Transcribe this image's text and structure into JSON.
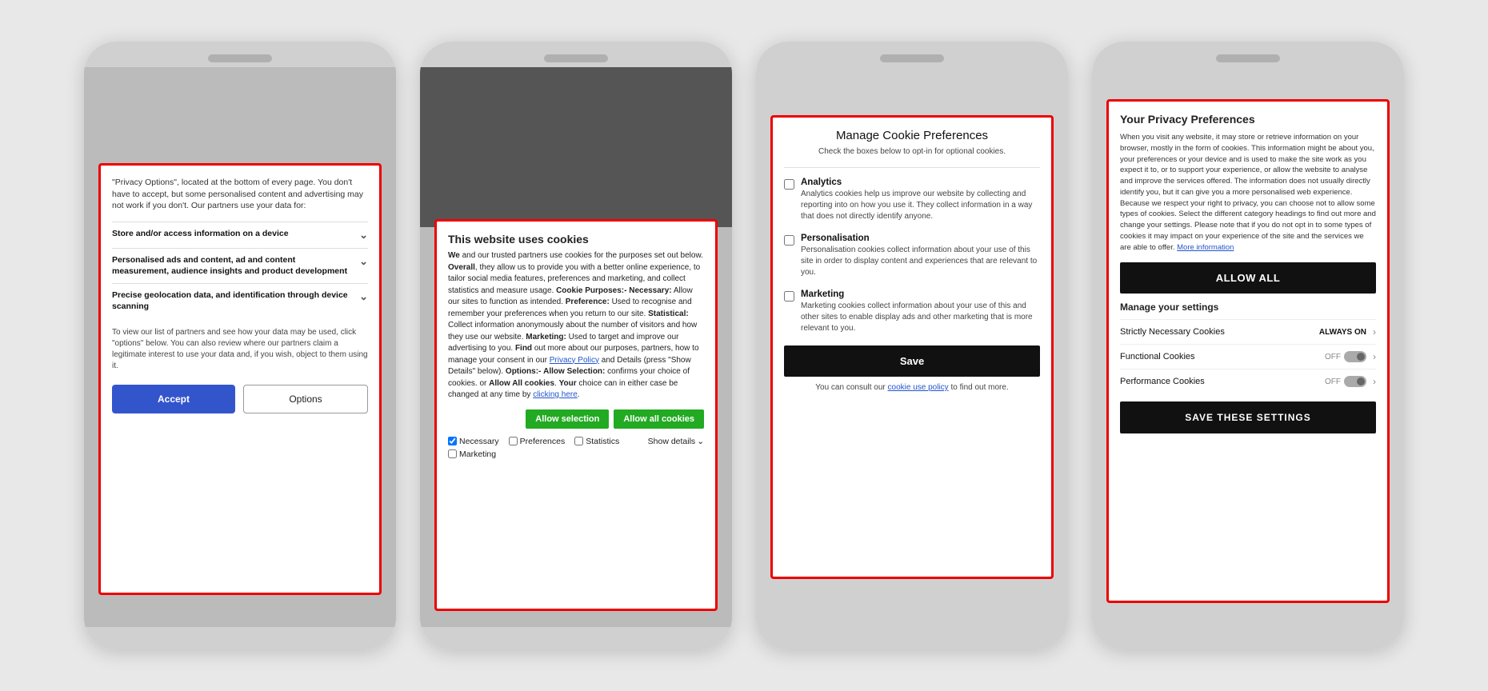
{
  "phone1": {
    "intro": "\"Privacy Options\", located at the bottom of every page. You don't have to accept, but some personalised content and advertising may not work if you don't. Our partners use your data for:",
    "items": [
      {
        "label": "Store and/or access information on a device"
      },
      {
        "label": "Personalised ads and content, ad and content measurement, audience insights and product development"
      },
      {
        "label": "Precise geolocation data, and identification through device scanning"
      }
    ],
    "partners_text": "To view our list of partners and see how your data may be used, click \"options\" below. You can also review where our partners claim a legitimate interest to use your data and, if you wish, object to them using it.",
    "btn_accept": "Accept",
    "btn_options": "Options"
  },
  "phone2": {
    "title": "This website uses cookies",
    "body_html": "We and our trusted partners use cookies for the purposes set out below. Overall, they allow us to provide you with a better online experience, to tailor social media features, preferences and marketing, and collect statistics and measure usage. Cookie Purposes:- Necessary: Allow our sites to function as intended. Preference: Used to recognise and remember your preferences when you return to our site. Statistical: Collect information anonymously about the number of visitors and how they use our website. Marketing: Used to target and improve our advertising to you. Find out more about our purposes, partners, how to manage your consent in our Privacy Policy and Details (press \"Show Details\" below). Options:- Allow Selection: confirms your choice of cookies. or Allow All cookies. Your choice can in either case be changed at any time by clicking here.",
    "btn_allow_selection": "Allow selection",
    "btn_allow_all": "Allow all cookies",
    "checkboxes": [
      {
        "label": "Necessary",
        "checked": true
      },
      {
        "label": "Preferences",
        "checked": false
      },
      {
        "label": "Statistics",
        "checked": false
      },
      {
        "label": "Marketing",
        "checked": false
      }
    ],
    "show_details": "Show details"
  },
  "phone3": {
    "title": "Manage Cookie Preferences",
    "subtitle": "Check the boxes below to opt-in for optional cookies.",
    "options": [
      {
        "label": "Analytics",
        "desc": "Analytics cookies help us improve our website by collecting and reporting into on how you use it. They collect information in a way that does not directly identify anyone.",
        "checked": false
      },
      {
        "label": "Personalisation",
        "desc": "Personalisation cookies collect information about your use of this site in order to display content and experiences that are relevant to you.",
        "checked": false
      },
      {
        "label": "Marketing",
        "desc": "Marketing cookies collect information about your use of this and other sites to enable display ads and other marketing that is more relevant to you.",
        "checked": false
      }
    ],
    "btn_save": "Save",
    "consult_text": "You can consult our",
    "consult_link": "cookie use policy",
    "consult_suffix": "to find out more."
  },
  "phone4": {
    "title": "Your Privacy Preferences",
    "body": "When you visit any website, it may store or retrieve information on your browser, mostly in the form of cookies. This information might be about you, your preferences or your device and is used to make the site work as you expect it to, or to support your experience, or allow the website to analyse and improve the services offered. The information does not usually directly identify you, but it can give you a more personalised web experience. Because we respect your right to privacy, you can choose not to allow some types of cookies. Select the different category headings to find out more and change your settings. Please note that if you do not opt in to some types of cookies it may impact on your experience of the site and the services we are able to offer.",
    "more_info": "More information",
    "btn_allow_all": "ALLOW ALL",
    "manage_title": "Manage your settings",
    "toggles": [
      {
        "label": "Strictly Necessary Cookies",
        "status": "ALWAYS ON",
        "type": "always"
      },
      {
        "label": "Functional Cookies",
        "status": "OFF",
        "type": "toggle"
      },
      {
        "label": "Performance Cookies",
        "status": "OFF",
        "type": "toggle"
      }
    ],
    "btn_save": "SAVE THESE SETTINGS"
  }
}
